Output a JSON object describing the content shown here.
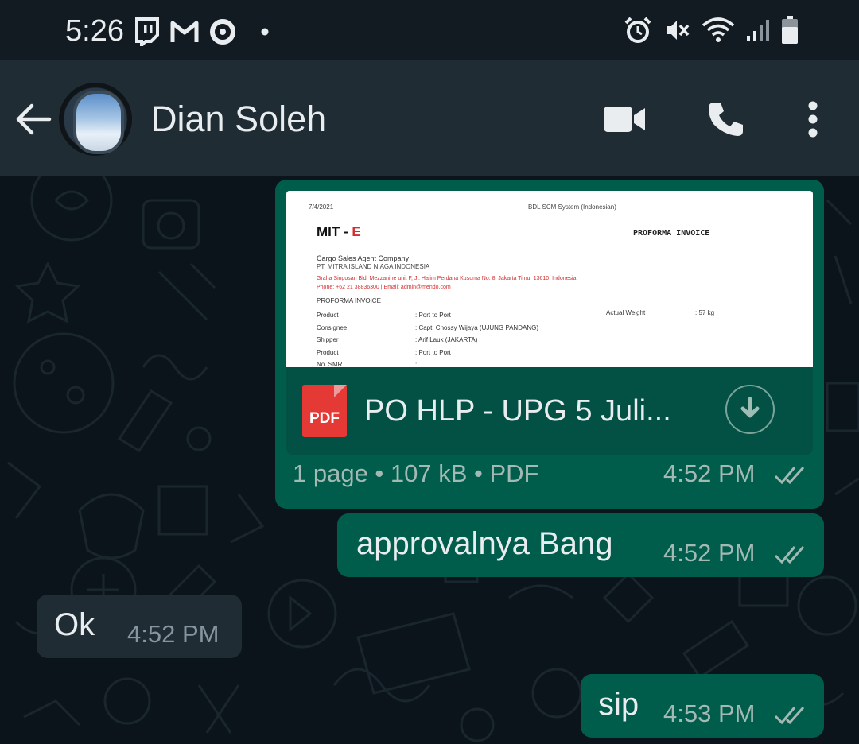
{
  "status_bar": {
    "time": "5:26",
    "left_icons": [
      "twitch-icon",
      "gmail-icon",
      "target-app-icon",
      "dot-icon"
    ],
    "right_icons": [
      "alarm-icon",
      "vibrate-mute-icon",
      "wifi-icon",
      "signal-icon",
      "battery-icon"
    ]
  },
  "header": {
    "contact_name": "Dian Soleh",
    "actions": [
      "video-call-icon",
      "voice-call-icon",
      "more-options-icon"
    ]
  },
  "messages": {
    "document": {
      "preview": {
        "date": "7/4/2021",
        "system": "BDL SCM System (Indonesian)",
        "logo_a": "MIT - ",
        "logo_b": "E",
        "doc_title": "PROFORMA INVOICE",
        "company": "Cargo Sales Agent Company",
        "company_legal": "PT. MITRA ISLAND NIAGA INDONESIA",
        "address": "Graha Singosari Bld. Mezzanine unit F, Jl. Halim Perdana Kusuma No. 8, Jakarta Timur 13610, Indonesia",
        "contact": "Phone: +62 21 38836300 | Email: admin@mendo.com",
        "section": "PROFORMA INVOICE",
        "rows": [
          {
            "label": "Product",
            "value": ": Port to Port"
          },
          {
            "label": "Consignee",
            "value": ": Capt. Chossy Wijaya (UJUNG PANDANG)"
          },
          {
            "label": "Shipper",
            "value": ": Arif Lauk (JAKARTA)"
          },
          {
            "label": "Product",
            "value": ": Port to Port"
          },
          {
            "label": "No. SMR",
            "value": ":"
          }
        ],
        "weight_label": "Actual Weight",
        "weight_value": ": 57 kg"
      },
      "file_icon_label": "PDF",
      "file_name": "PO HLP - UPG 5 Juli...",
      "meta": "1 page • 107 kB • PDF",
      "time": "4:52 PM",
      "status": "read"
    },
    "out_1": {
      "text": "approvalnya Bang",
      "time": "4:52 PM",
      "status": "read"
    },
    "in_1": {
      "text": "Ok",
      "time": "4:52 PM"
    },
    "out_2": {
      "text": "sip",
      "time": "4:53 PM",
      "status": "read"
    }
  },
  "colors": {
    "outgoing_bubble": "#005c4b",
    "incoming_bubble": "#1f2c34",
    "header": "#1f2c34",
    "chat_background": "#0b141a",
    "pdf_red": "#e53935"
  }
}
